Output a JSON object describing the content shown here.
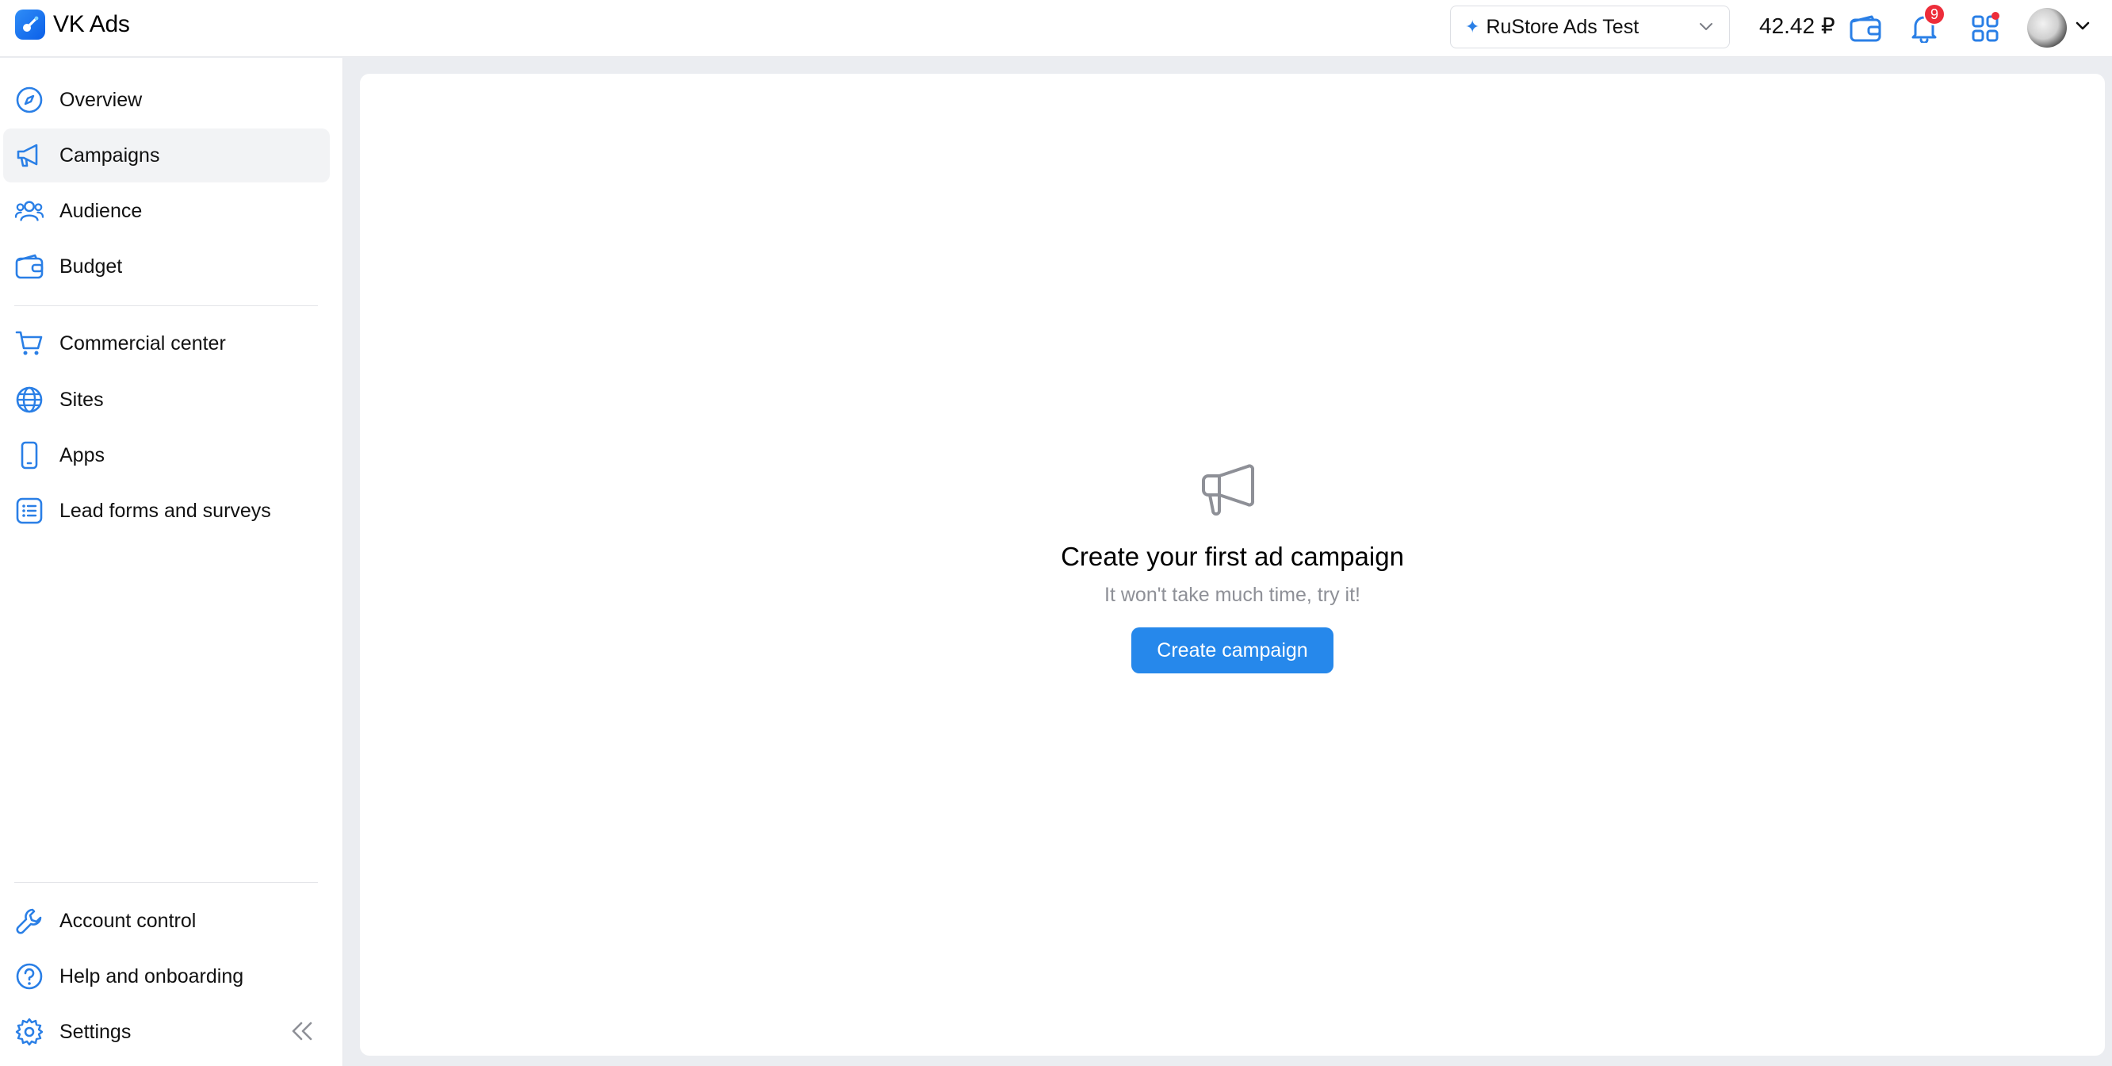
{
  "app": {
    "title": "VK Ads"
  },
  "header": {
    "account_name": "RuStore Ads Test",
    "balance": "42.42 ₽",
    "notifications_count": "9"
  },
  "sidebar": {
    "items": [
      {
        "label": "Overview",
        "icon": "compass-icon"
      },
      {
        "label": "Campaigns",
        "icon": "megaphone-icon",
        "active": true
      },
      {
        "label": "Audience",
        "icon": "users-icon"
      },
      {
        "label": "Budget",
        "icon": "wallet-icon"
      },
      {
        "label": "Commercial center",
        "icon": "cart-icon"
      },
      {
        "label": "Sites",
        "icon": "globe-icon"
      },
      {
        "label": "Apps",
        "icon": "phone-icon"
      },
      {
        "label": "Lead forms and surveys",
        "icon": "list-icon"
      }
    ],
    "bottom_items": [
      {
        "label": "Account control",
        "icon": "wrench-icon"
      },
      {
        "label": "Help and onboarding",
        "icon": "help-icon"
      },
      {
        "label": "Settings",
        "icon": "gear-icon"
      }
    ]
  },
  "main": {
    "empty_title": "Create your first ad campaign",
    "empty_subtitle": "It won't take much time, try it!",
    "create_button": "Create campaign"
  },
  "colors": {
    "accent": "#2688eb",
    "icon_blue": "#2a7fe6",
    "badge_red": "#ed2d3a",
    "page_bg": "#ebedf1"
  }
}
